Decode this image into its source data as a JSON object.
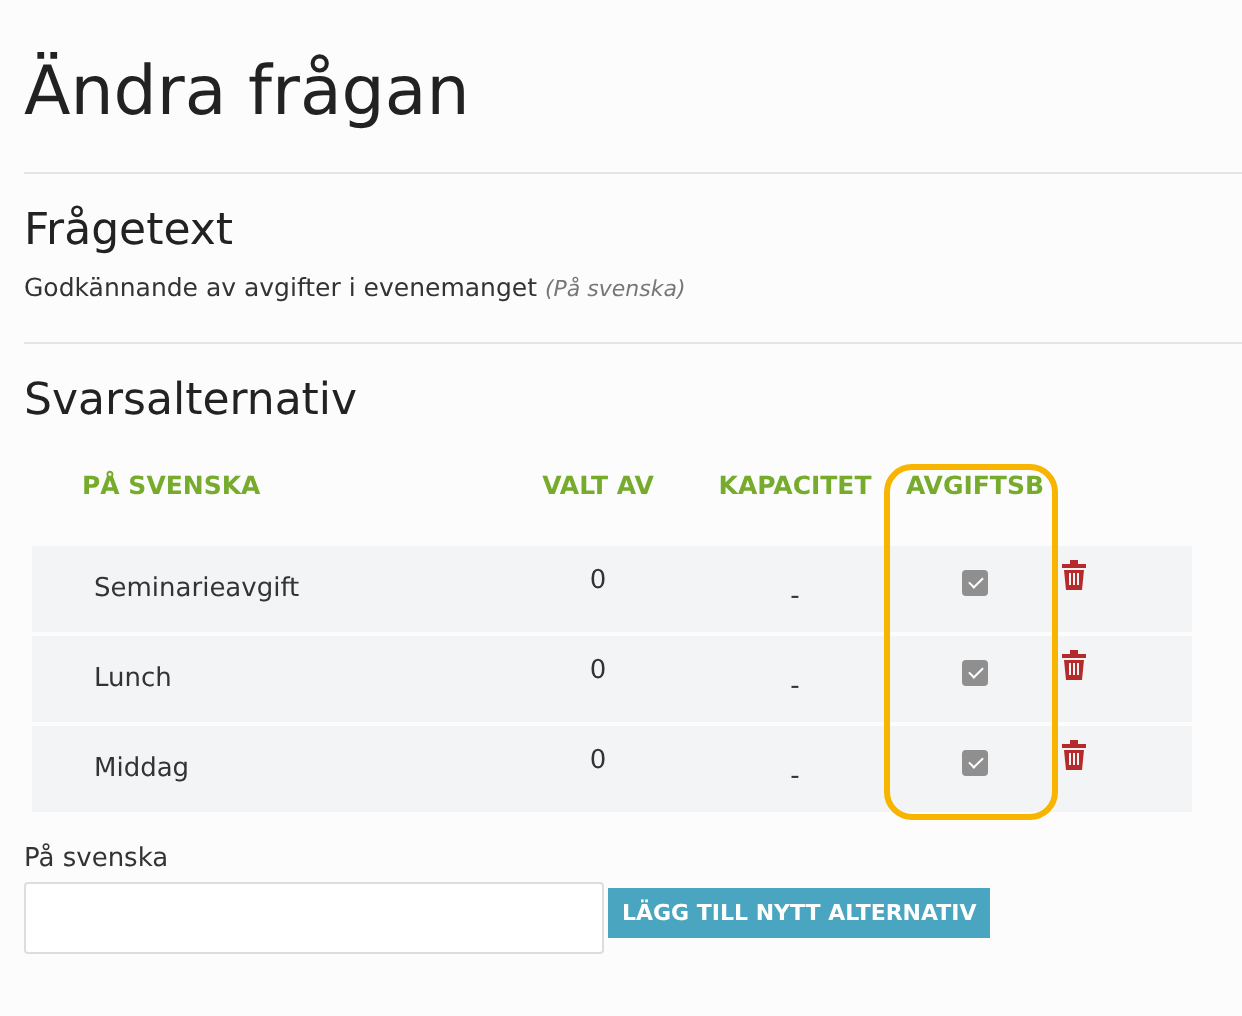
{
  "title": "Ändra frågan",
  "question": {
    "heading": "Frågetext",
    "text": "Godkännande av avgifter i evenemanget",
    "language": "(På svenska)"
  },
  "answers": {
    "heading": "Svarsalternativ",
    "columns": [
      "PÅ SVENSKA",
      "VALT AV",
      "KAPACITET",
      "AVGIFTSB"
    ],
    "rows": [
      {
        "name": "Seminarieavgift",
        "chosen_by": "0",
        "capacity": "-",
        "fee": true
      },
      {
        "name": "Lunch",
        "chosen_by": "0",
        "capacity": "-",
        "fee": true
      },
      {
        "name": "Middag",
        "chosen_by": "0",
        "capacity": "-",
        "fee": true
      }
    ]
  },
  "new_option": {
    "label": "På svenska",
    "button": "LÄGG TILL NYTT ALTERNATIV"
  }
}
